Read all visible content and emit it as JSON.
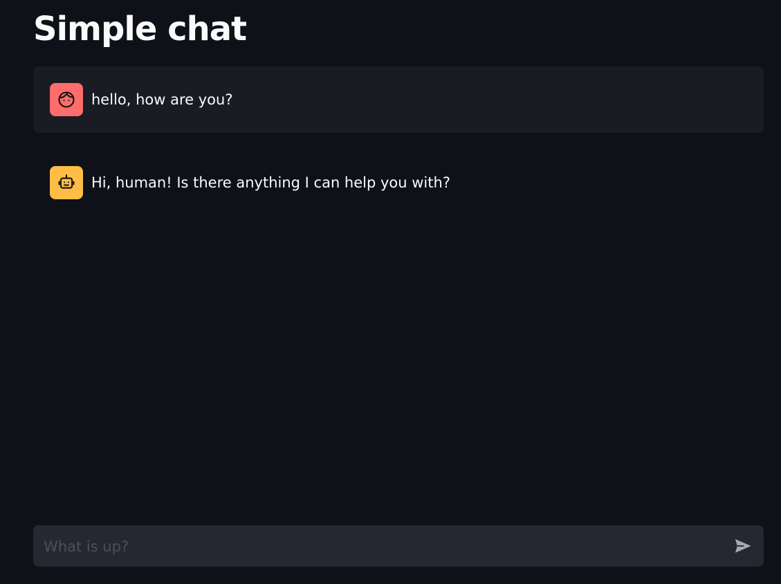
{
  "page": {
    "title": "Simple chat"
  },
  "messages": [
    {
      "role": "user",
      "text": "hello, how are you?",
      "avatar_icon": "face-icon",
      "avatar_color": "#ff6c6c"
    },
    {
      "role": "assistant",
      "text": "Hi, human! Is there anything I can help you with?",
      "avatar_icon": "robot-icon",
      "avatar_color": "#ffbd45"
    }
  ],
  "chat_input": {
    "placeholder": "What is up?",
    "value": "",
    "send_icon": "send-icon"
  },
  "colors": {
    "background": "#0e1117",
    "user_message_background": "#1a1c24",
    "input_background": "#262730",
    "text": "#fafafa",
    "send_icon": "#a3a8b4"
  }
}
